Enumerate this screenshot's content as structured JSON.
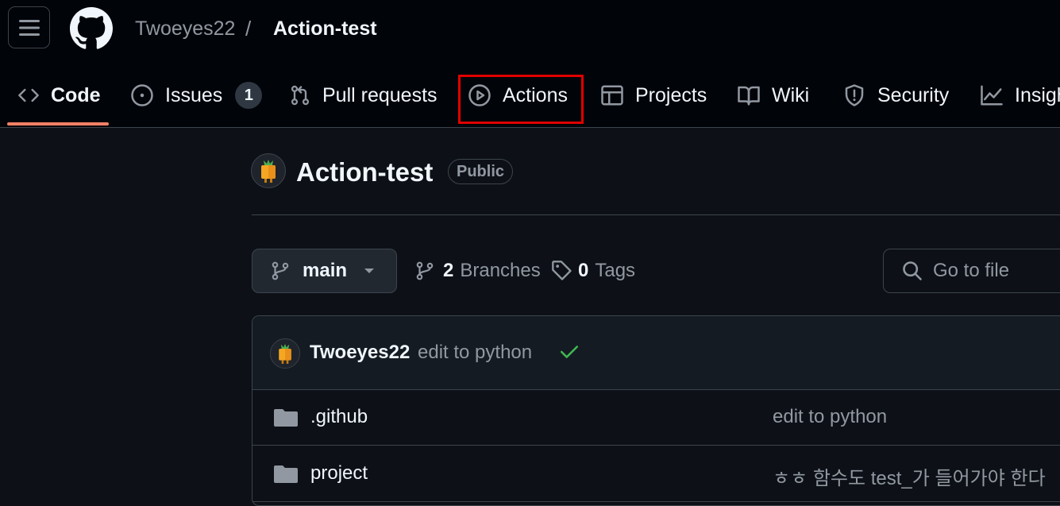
{
  "header": {
    "owner": "Twoeyes22",
    "separator": "/",
    "repo": "Action-test"
  },
  "tabs": [
    {
      "label": "Code",
      "icon": "code-icon",
      "active": true
    },
    {
      "label": "Issues",
      "icon": "issue-opened-icon",
      "counter": "1"
    },
    {
      "label": "Pull requests",
      "icon": "git-pull-request-icon"
    },
    {
      "label": "Actions",
      "icon": "play-icon",
      "highlighted": true
    },
    {
      "label": "Projects",
      "icon": "table-icon"
    },
    {
      "label": "Wiki",
      "icon": "book-icon"
    },
    {
      "label": "Security",
      "icon": "shield-icon"
    },
    {
      "label": "Insights",
      "icon": "graph-icon"
    }
  ],
  "repo": {
    "title": "Action-test",
    "visibility": "Public"
  },
  "toolbar": {
    "branch": "main",
    "branches_count": "2",
    "branches_label": "Branches",
    "tags_count": "0",
    "tags_label": "Tags",
    "goto_placeholder": "Go to file"
  },
  "latest_commit": {
    "author": "Twoeyes22",
    "message": "edit to python",
    "status": "success"
  },
  "files": [
    {
      "name": ".github",
      "type": "folder",
      "message": "edit to python"
    },
    {
      "name": "project",
      "type": "folder",
      "message": "ㅎㅎ 함수도 test_가 들어가야 한다"
    }
  ],
  "colors": {
    "accent_underline": "#f78166",
    "highlight_box": "#e00000",
    "success": "#3fb950"
  }
}
